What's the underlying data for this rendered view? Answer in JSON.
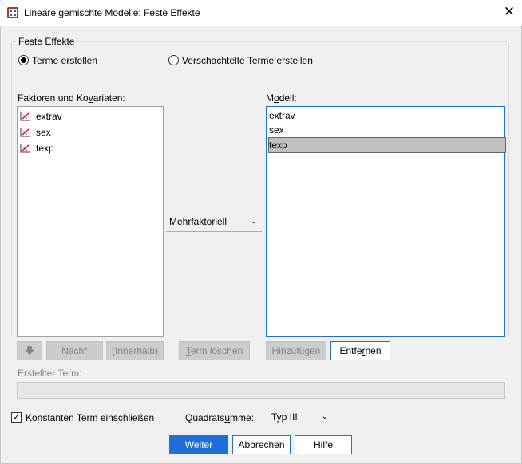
{
  "window": {
    "title": "Lineare gemischte Modelle: Feste Effekte",
    "close_glyph": "✕"
  },
  "group": {
    "title": "Feste Effekte"
  },
  "mode": {
    "build_terms": "Terme erstellen",
    "nested_terms_pre": "Verschachtelte Terme erstelle",
    "nested_terms_u": "n",
    "selected": "build_terms"
  },
  "factors": {
    "label_pre": "Faktoren und Ko",
    "label_u": "v",
    "label_post": "ariaten:",
    "items": [
      {
        "label": "extrav",
        "icon": "scale-variable-icon"
      },
      {
        "label": "sex",
        "icon": "scale-variable-icon"
      },
      {
        "label": "texp",
        "icon": "scale-variable-icon"
      }
    ]
  },
  "model": {
    "label_pre": "M",
    "label_u": "o",
    "label_post": "dell:",
    "items": [
      {
        "label": "extrav",
        "selected": false
      },
      {
        "label": "sex",
        "selected": false
      },
      {
        "label": "texp",
        "selected": true
      }
    ]
  },
  "term_type": {
    "selected": "Mehrfaktoriell",
    "chevron": "⌄"
  },
  "buttons": {
    "move_glyph": "🡇",
    "by": "Nach*",
    "within": "(Innerhalb)",
    "clear_term_u": "T",
    "clear_term_post": "erm löschen",
    "add": "Hinzufügen",
    "remove_pre": "Entfe",
    "remove_u": "r",
    "remove_post": "nen",
    "continue": "Weiter",
    "cancel": "Abbrechen",
    "help": "Hilfe"
  },
  "built_term": {
    "label": "Erstellter Term:",
    "value": ""
  },
  "intercept": {
    "label": "Konstanten Term einschließen",
    "checked": true,
    "check_glyph": "✓"
  },
  "sum_of_squares": {
    "label_pre": "Quadrats",
    "label_u": "u",
    "label_post": "mme:",
    "selected": "Typ III",
    "chevron": "⌄"
  }
}
